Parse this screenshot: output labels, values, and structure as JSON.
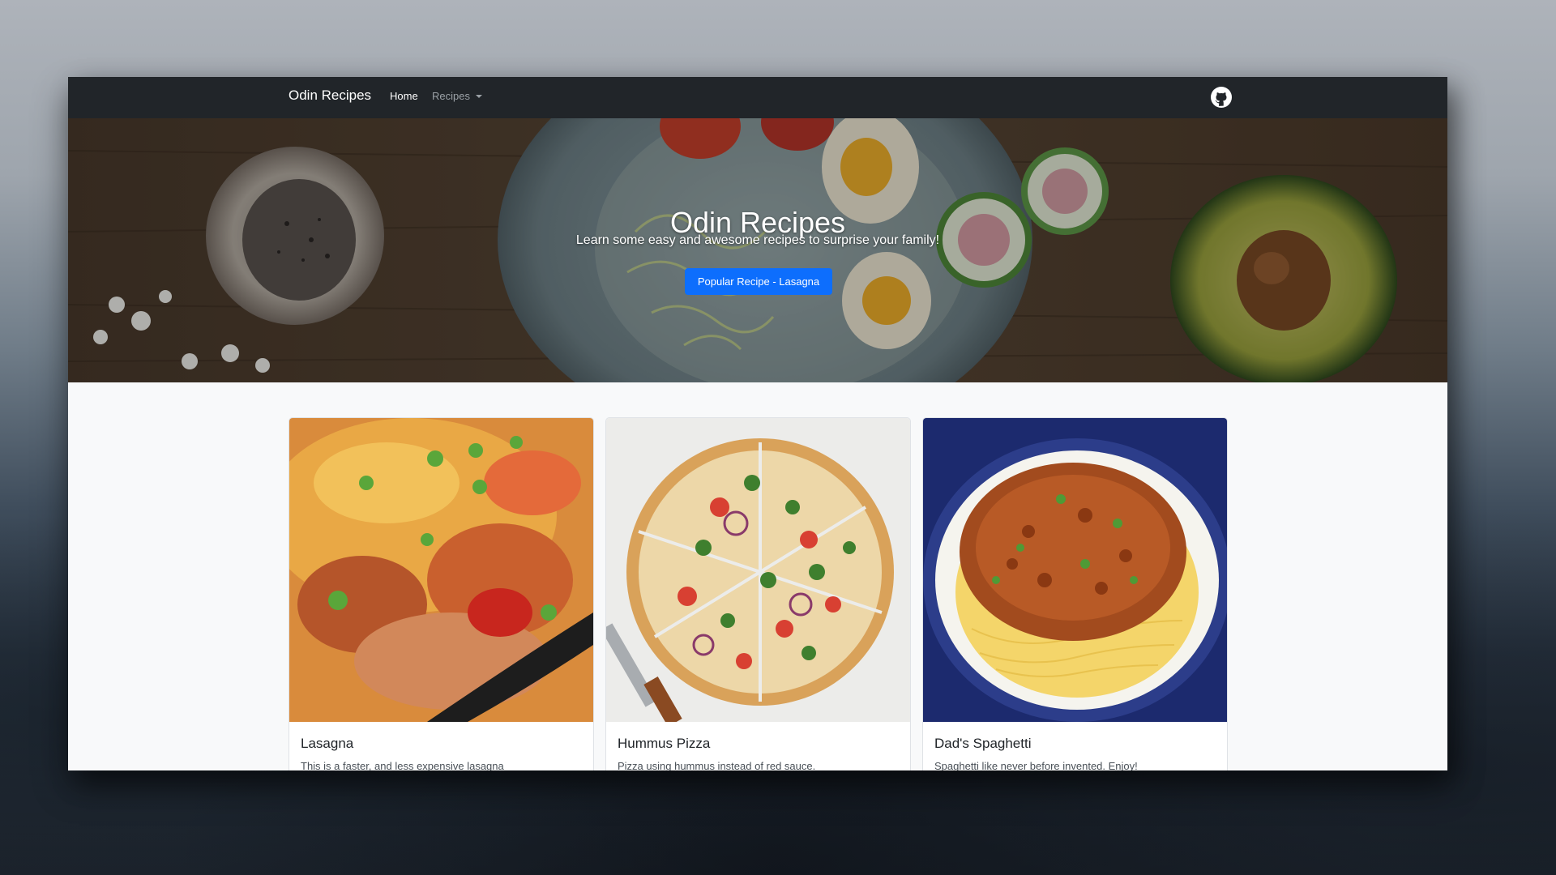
{
  "navbar": {
    "brand": "Odin Recipes",
    "home_label": "Home",
    "recipes_label": "Recipes"
  },
  "hero": {
    "title": "Odin Recipes",
    "subtitle": "Learn some easy and awesome recipes to surprise your family!",
    "button_label": "Popular Recipe - Lasagna"
  },
  "cards": [
    {
      "title": "Lasagna",
      "text": "This is a faster, and less expensive lasagna"
    },
    {
      "title": "Hummus Pizza",
      "text": "Pizza using hummus instead of red sauce."
    },
    {
      "title": "Dad's Spaghetti",
      "text": "Spaghetti like never before invented. Enjoy!"
    }
  ],
  "colors": {
    "navbar": "#212529",
    "primary": "#0d6efd",
    "page": "#f8f9fa"
  },
  "icons": {
    "github": "github-icon",
    "dropdown": "chevron-down-icon"
  }
}
